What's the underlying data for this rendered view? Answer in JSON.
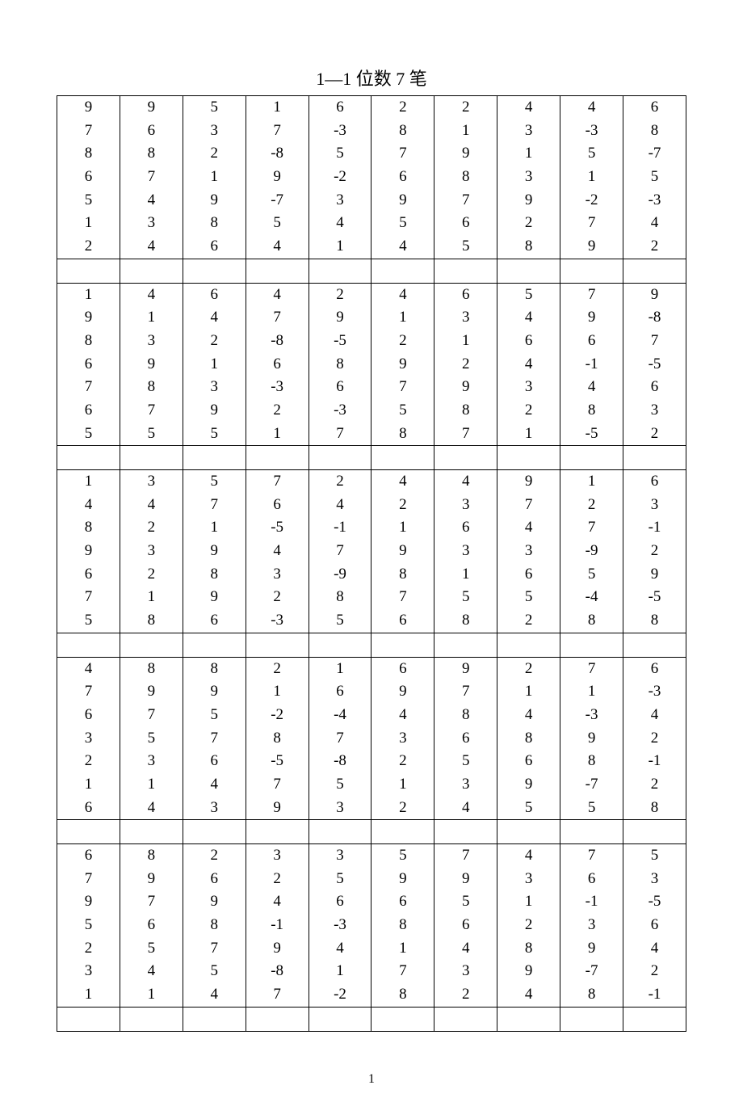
{
  "title": "1—1 位数 7 笔",
  "page_number": "1",
  "blocks": [
    [
      [
        "9",
        "9",
        "5",
        "1",
        "6",
        "2",
        "2",
        "4",
        "4",
        "6"
      ],
      [
        "7",
        "6",
        "3",
        "7",
        "-3",
        "8",
        "1",
        "3",
        "-3",
        "8"
      ],
      [
        "8",
        "8",
        "2",
        "-8",
        "5",
        "7",
        "9",
        "1",
        "5",
        "-7"
      ],
      [
        "6",
        "7",
        "1",
        "9",
        "-2",
        "6",
        "8",
        "3",
        "1",
        "5"
      ],
      [
        "5",
        "4",
        "9",
        "-7",
        "3",
        "9",
        "7",
        "9",
        "-2",
        "-3"
      ],
      [
        "1",
        "3",
        "8",
        "5",
        "4",
        "5",
        "6",
        "2",
        "7",
        "4"
      ],
      [
        "2",
        "4",
        "6",
        "4",
        "1",
        "4",
        "5",
        "8",
        "9",
        "2"
      ]
    ],
    [
      [
        "1",
        "4",
        "6",
        "4",
        "2",
        "4",
        "6",
        "5",
        "7",
        "9"
      ],
      [
        "9",
        "1",
        "4",
        "7",
        "9",
        "1",
        "3",
        "4",
        "9",
        "-8"
      ],
      [
        "8",
        "3",
        "2",
        "-8",
        "-5",
        "2",
        "1",
        "6",
        "6",
        "7"
      ],
      [
        "6",
        "9",
        "1",
        "6",
        "8",
        "9",
        "2",
        "4",
        "-1",
        "-5"
      ],
      [
        "7",
        "8",
        "3",
        "-3",
        "6",
        "7",
        "9",
        "3",
        "4",
        "6"
      ],
      [
        "6",
        "7",
        "9",
        "2",
        "-3",
        "5",
        "8",
        "2",
        "8",
        "3"
      ],
      [
        "5",
        "5",
        "5",
        "1",
        "7",
        "8",
        "7",
        "1",
        "-5",
        "2"
      ]
    ],
    [
      [
        "1",
        "3",
        "5",
        "7",
        "2",
        "4",
        "4",
        "9",
        "1",
        "6"
      ],
      [
        "4",
        "4",
        "7",
        "6",
        "4",
        "2",
        "3",
        "7",
        "2",
        "3"
      ],
      [
        "8",
        "2",
        "1",
        "-5",
        "-1",
        "1",
        "6",
        "4",
        "7",
        "-1"
      ],
      [
        "9",
        "3",
        "9",
        "4",
        "7",
        "9",
        "3",
        "3",
        "-9",
        "2"
      ],
      [
        "6",
        "2",
        "8",
        "3",
        "-9",
        "8",
        "1",
        "6",
        "5",
        "9"
      ],
      [
        "7",
        "1",
        "9",
        "2",
        "8",
        "7",
        "5",
        "5",
        "-4",
        "-5"
      ],
      [
        "5",
        "8",
        "6",
        "-3",
        "5",
        "6",
        "8",
        "2",
        "8",
        "8"
      ]
    ],
    [
      [
        "4",
        "8",
        "8",
        "2",
        "1",
        "6",
        "9",
        "2",
        "7",
        "6"
      ],
      [
        "7",
        "9",
        "9",
        "1",
        "6",
        "9",
        "7",
        "1",
        "1",
        "-3"
      ],
      [
        "6",
        "7",
        "5",
        "-2",
        "-4",
        "4",
        "8",
        "4",
        "-3",
        "4"
      ],
      [
        "3",
        "5",
        "7",
        "8",
        "7",
        "3",
        "6",
        "8",
        "9",
        "2"
      ],
      [
        "2",
        "3",
        "6",
        "-5",
        "-8",
        "2",
        "5",
        "6",
        "8",
        "-1"
      ],
      [
        "1",
        "1",
        "4",
        "7",
        "5",
        "1",
        "3",
        "9",
        "-7",
        "2"
      ],
      [
        "6",
        "4",
        "3",
        "9",
        "3",
        "2",
        "4",
        "5",
        "5",
        "8"
      ]
    ],
    [
      [
        "6",
        "8",
        "2",
        "3",
        "3",
        "5",
        "7",
        "4",
        "7",
        "5"
      ],
      [
        "7",
        "9",
        "6",
        "2",
        "5",
        "9",
        "9",
        "3",
        "6",
        "3"
      ],
      [
        "9",
        "7",
        "9",
        "4",
        "6",
        "6",
        "5",
        "1",
        "-1",
        "-5"
      ],
      [
        "5",
        "6",
        "8",
        "-1",
        "-3",
        "8",
        "6",
        "2",
        "3",
        "6"
      ],
      [
        "2",
        "5",
        "7",
        "9",
        "4",
        "1",
        "4",
        "8",
        "9",
        "4"
      ],
      [
        "3",
        "4",
        "5",
        "-8",
        "1",
        "7",
        "3",
        "9",
        "-7",
        "2"
      ],
      [
        "1",
        "1",
        "4",
        "7",
        "-2",
        "8",
        "2",
        "4",
        "8",
        "-1"
      ]
    ]
  ]
}
